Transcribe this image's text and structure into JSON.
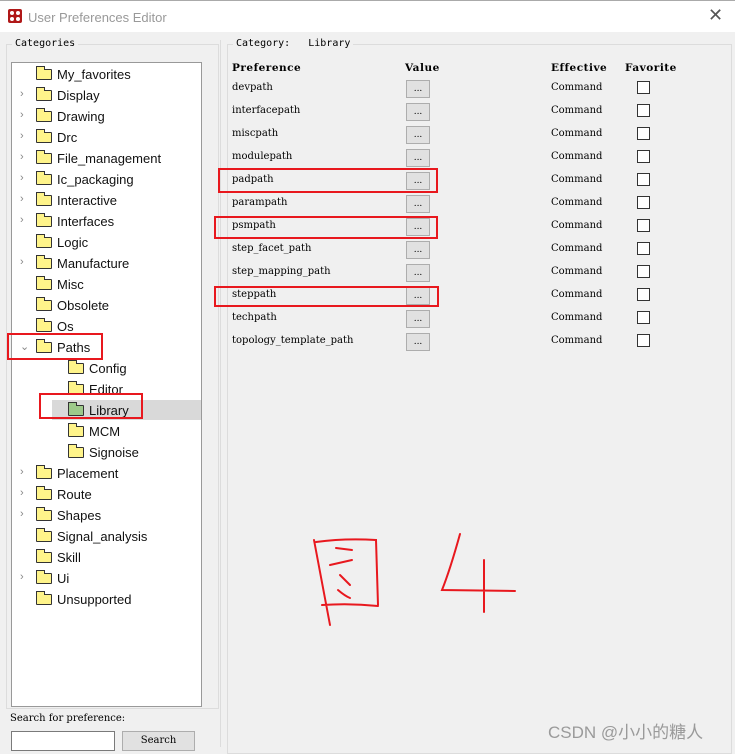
{
  "window": {
    "title": "User Preferences Editor",
    "close_icon": "close-icon"
  },
  "categories": {
    "label": "Categories",
    "tree": [
      {
        "label": "My_favorites",
        "expander": false,
        "level": 0
      },
      {
        "label": "Display",
        "expander": true,
        "level": 0
      },
      {
        "label": "Drawing",
        "expander": true,
        "level": 0
      },
      {
        "label": "Drc",
        "expander": true,
        "level": 0
      },
      {
        "label": "File_management",
        "expander": true,
        "level": 0
      },
      {
        "label": "Ic_packaging",
        "expander": true,
        "level": 0
      },
      {
        "label": "Interactive",
        "expander": true,
        "level": 0
      },
      {
        "label": "Interfaces",
        "expander": true,
        "level": 0
      },
      {
        "label": "Logic",
        "expander": false,
        "level": 0
      },
      {
        "label": "Manufacture",
        "expander": true,
        "level": 0
      },
      {
        "label": "Misc",
        "expander": false,
        "level": 0
      },
      {
        "label": "Obsolete",
        "expander": false,
        "level": 0
      },
      {
        "label": "Os",
        "expander": false,
        "level": 0
      },
      {
        "label": "Paths",
        "expander": true,
        "expanded": true,
        "level": 0
      },
      {
        "label": "Config",
        "expander": false,
        "level": 1
      },
      {
        "label": "Editor",
        "expander": false,
        "level": 1
      },
      {
        "label": "Library",
        "expander": false,
        "level": 1,
        "selected": true
      },
      {
        "label": "MCM",
        "expander": false,
        "level": 1
      },
      {
        "label": "Signoise",
        "expander": false,
        "level": 1
      },
      {
        "label": "Placement",
        "expander": true,
        "level": 0
      },
      {
        "label": "Route",
        "expander": true,
        "level": 0
      },
      {
        "label": "Shapes",
        "expander": true,
        "level": 0
      },
      {
        "label": "Signal_analysis",
        "expander": false,
        "level": 0
      },
      {
        "label": "Skill",
        "expander": false,
        "level": 0
      },
      {
        "label": "Ui",
        "expander": true,
        "level": 0
      },
      {
        "label": "Unsupported",
        "expander": false,
        "level": 0
      }
    ]
  },
  "category": {
    "label": "Category:",
    "value": "Library",
    "headers": {
      "preference": "Preference",
      "value": "Value",
      "effective": "Effective",
      "favorite": "Favorite"
    },
    "rows": [
      {
        "name": "devpath",
        "value": "...",
        "effective": "Command",
        "favorite": false
      },
      {
        "name": "interfacepath",
        "value": "...",
        "effective": "Command",
        "favorite": false
      },
      {
        "name": "miscpath",
        "value": "...",
        "effective": "Command",
        "favorite": false
      },
      {
        "name": "modulepath",
        "value": "...",
        "effective": "Command",
        "favorite": false
      },
      {
        "name": "padpath",
        "value": "...",
        "effective": "Command",
        "favorite": false,
        "highlighted": true
      },
      {
        "name": "parampath",
        "value": "...",
        "effective": "Command",
        "favorite": false
      },
      {
        "name": "psmpath",
        "value": "...",
        "effective": "Command",
        "favorite": false,
        "highlighted": true
      },
      {
        "name": "step_facet_path",
        "value": "...",
        "effective": "Command",
        "favorite": false
      },
      {
        "name": "step_mapping_path",
        "value": "...",
        "effective": "Command",
        "favorite": false
      },
      {
        "name": "steppath",
        "value": "...",
        "effective": "Command",
        "favorite": false,
        "highlighted": true
      },
      {
        "name": "techpath",
        "value": "...",
        "effective": "Command",
        "favorite": false
      },
      {
        "name": "topology_template_path",
        "value": "...",
        "effective": "Command",
        "favorite": false
      }
    ]
  },
  "search": {
    "label": "Search for preference:",
    "value": "",
    "button": "Search"
  },
  "annotation": {
    "text": "图4",
    "color": "#e8181e"
  },
  "watermark": "CSDN @小小的糖人"
}
